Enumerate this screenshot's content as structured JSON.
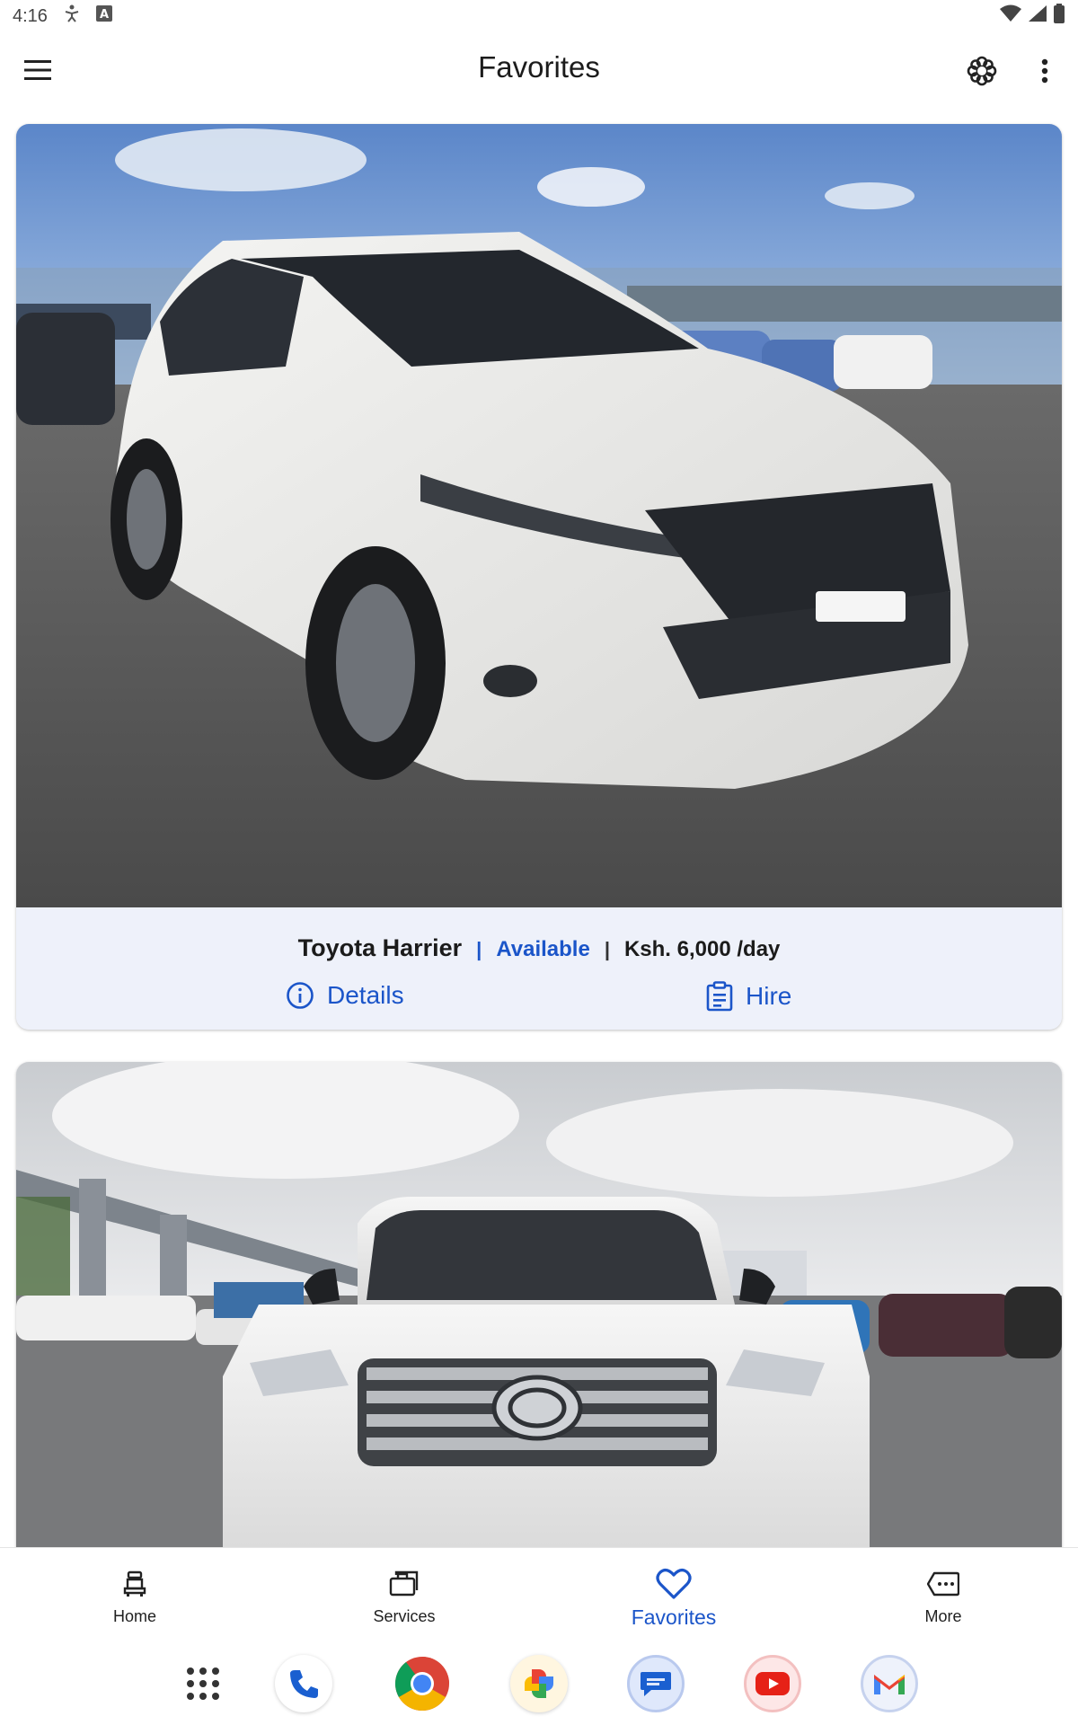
{
  "status_bar": {
    "time": "4:16"
  },
  "app_bar": {
    "title": "Favorites"
  },
  "cars": [
    {
      "name": "Toyota Harrier",
      "availability": "Available",
      "separator": "|",
      "price": "Ksh. 6,000 /day",
      "details_label": "Details",
      "hire_label": "Hire"
    },
    {
      "name": "",
      "availability": "",
      "price": ""
    }
  ],
  "bottom_nav": {
    "items": [
      {
        "label": "Home",
        "icon": "car-seat-icon"
      },
      {
        "label": "Services",
        "icon": "briefcase-icon"
      },
      {
        "label": "Favorites",
        "icon": "heart-icon"
      },
      {
        "label": "More",
        "icon": "more-message-icon"
      }
    ],
    "active": "Favorites"
  },
  "colors": {
    "accent": "#1b55c9",
    "card_background": "#eef1fa"
  },
  "dock": {
    "apps": [
      "app-drawer-icon",
      "phone-icon",
      "chrome-icon",
      "photos-icon",
      "messages-icon",
      "youtube-icon",
      "gmail-icon"
    ]
  }
}
